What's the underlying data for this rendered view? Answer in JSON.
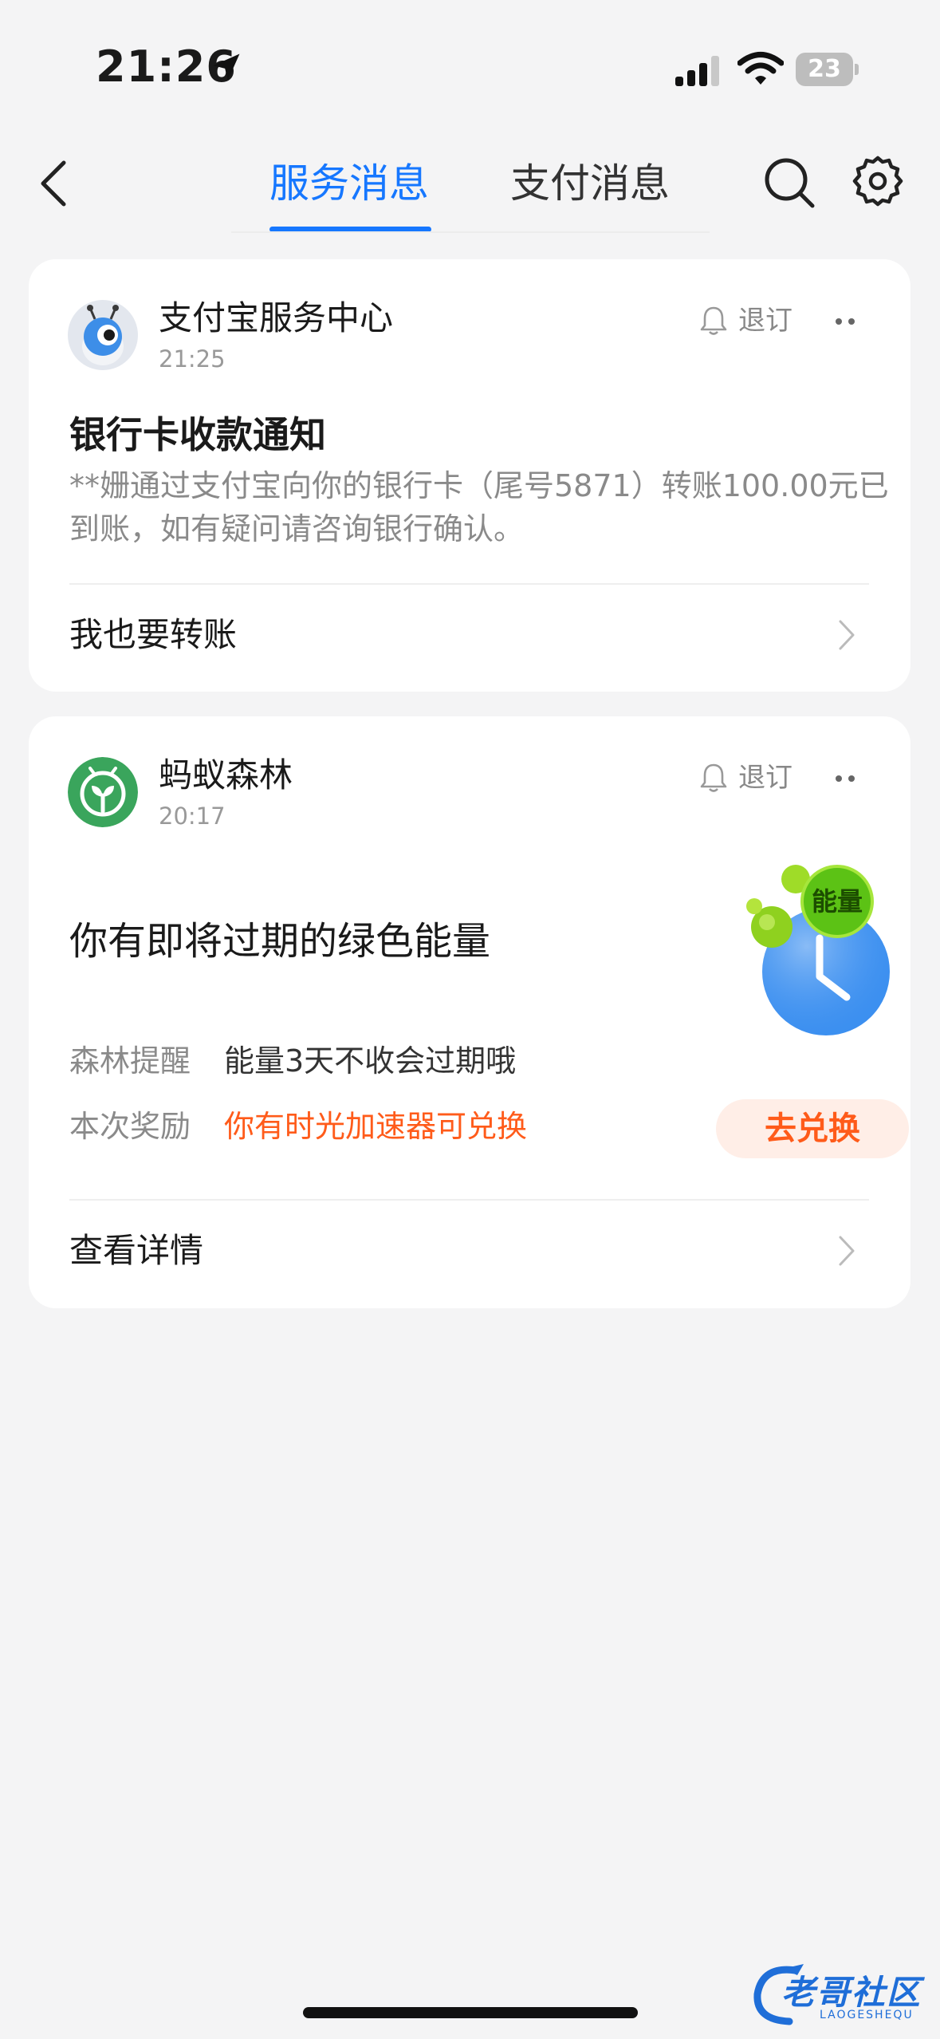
{
  "status_bar": {
    "time": "21:26",
    "battery": "23"
  },
  "nav": {
    "tabs": [
      {
        "label": "服务消息",
        "active": true
      },
      {
        "label": "支付消息",
        "active": false
      }
    ]
  },
  "cards": [
    {
      "sender": "支付宝服务中心",
      "time": "21:25",
      "unsubscribe": "退订",
      "title": "银行卡收款通知",
      "body": "**姗通过支付宝向你的银行卡（尾号5871）转账100.00元已到账，如有疑问请咨询银行确认。",
      "action": "我也要转账"
    },
    {
      "sender": "蚂蚁森林",
      "time": "20:17",
      "unsubscribe": "退订",
      "title": "你有即将过期的绿色能量",
      "badge": "能量",
      "rows": [
        {
          "key": "森林提醒",
          "value": "能量3天不收会过期哦"
        },
        {
          "key": "本次奖励",
          "value": "你有时光加速器可兑换"
        }
      ],
      "redeem": "去兑换",
      "action": "查看详情"
    }
  ],
  "watermark": {
    "text": "老哥社区",
    "sub": "LAOGESHEQU"
  },
  "colors": {
    "accent": "#1677ff",
    "orange": "#ff5b1a",
    "forest_green": "#3aa55c"
  }
}
